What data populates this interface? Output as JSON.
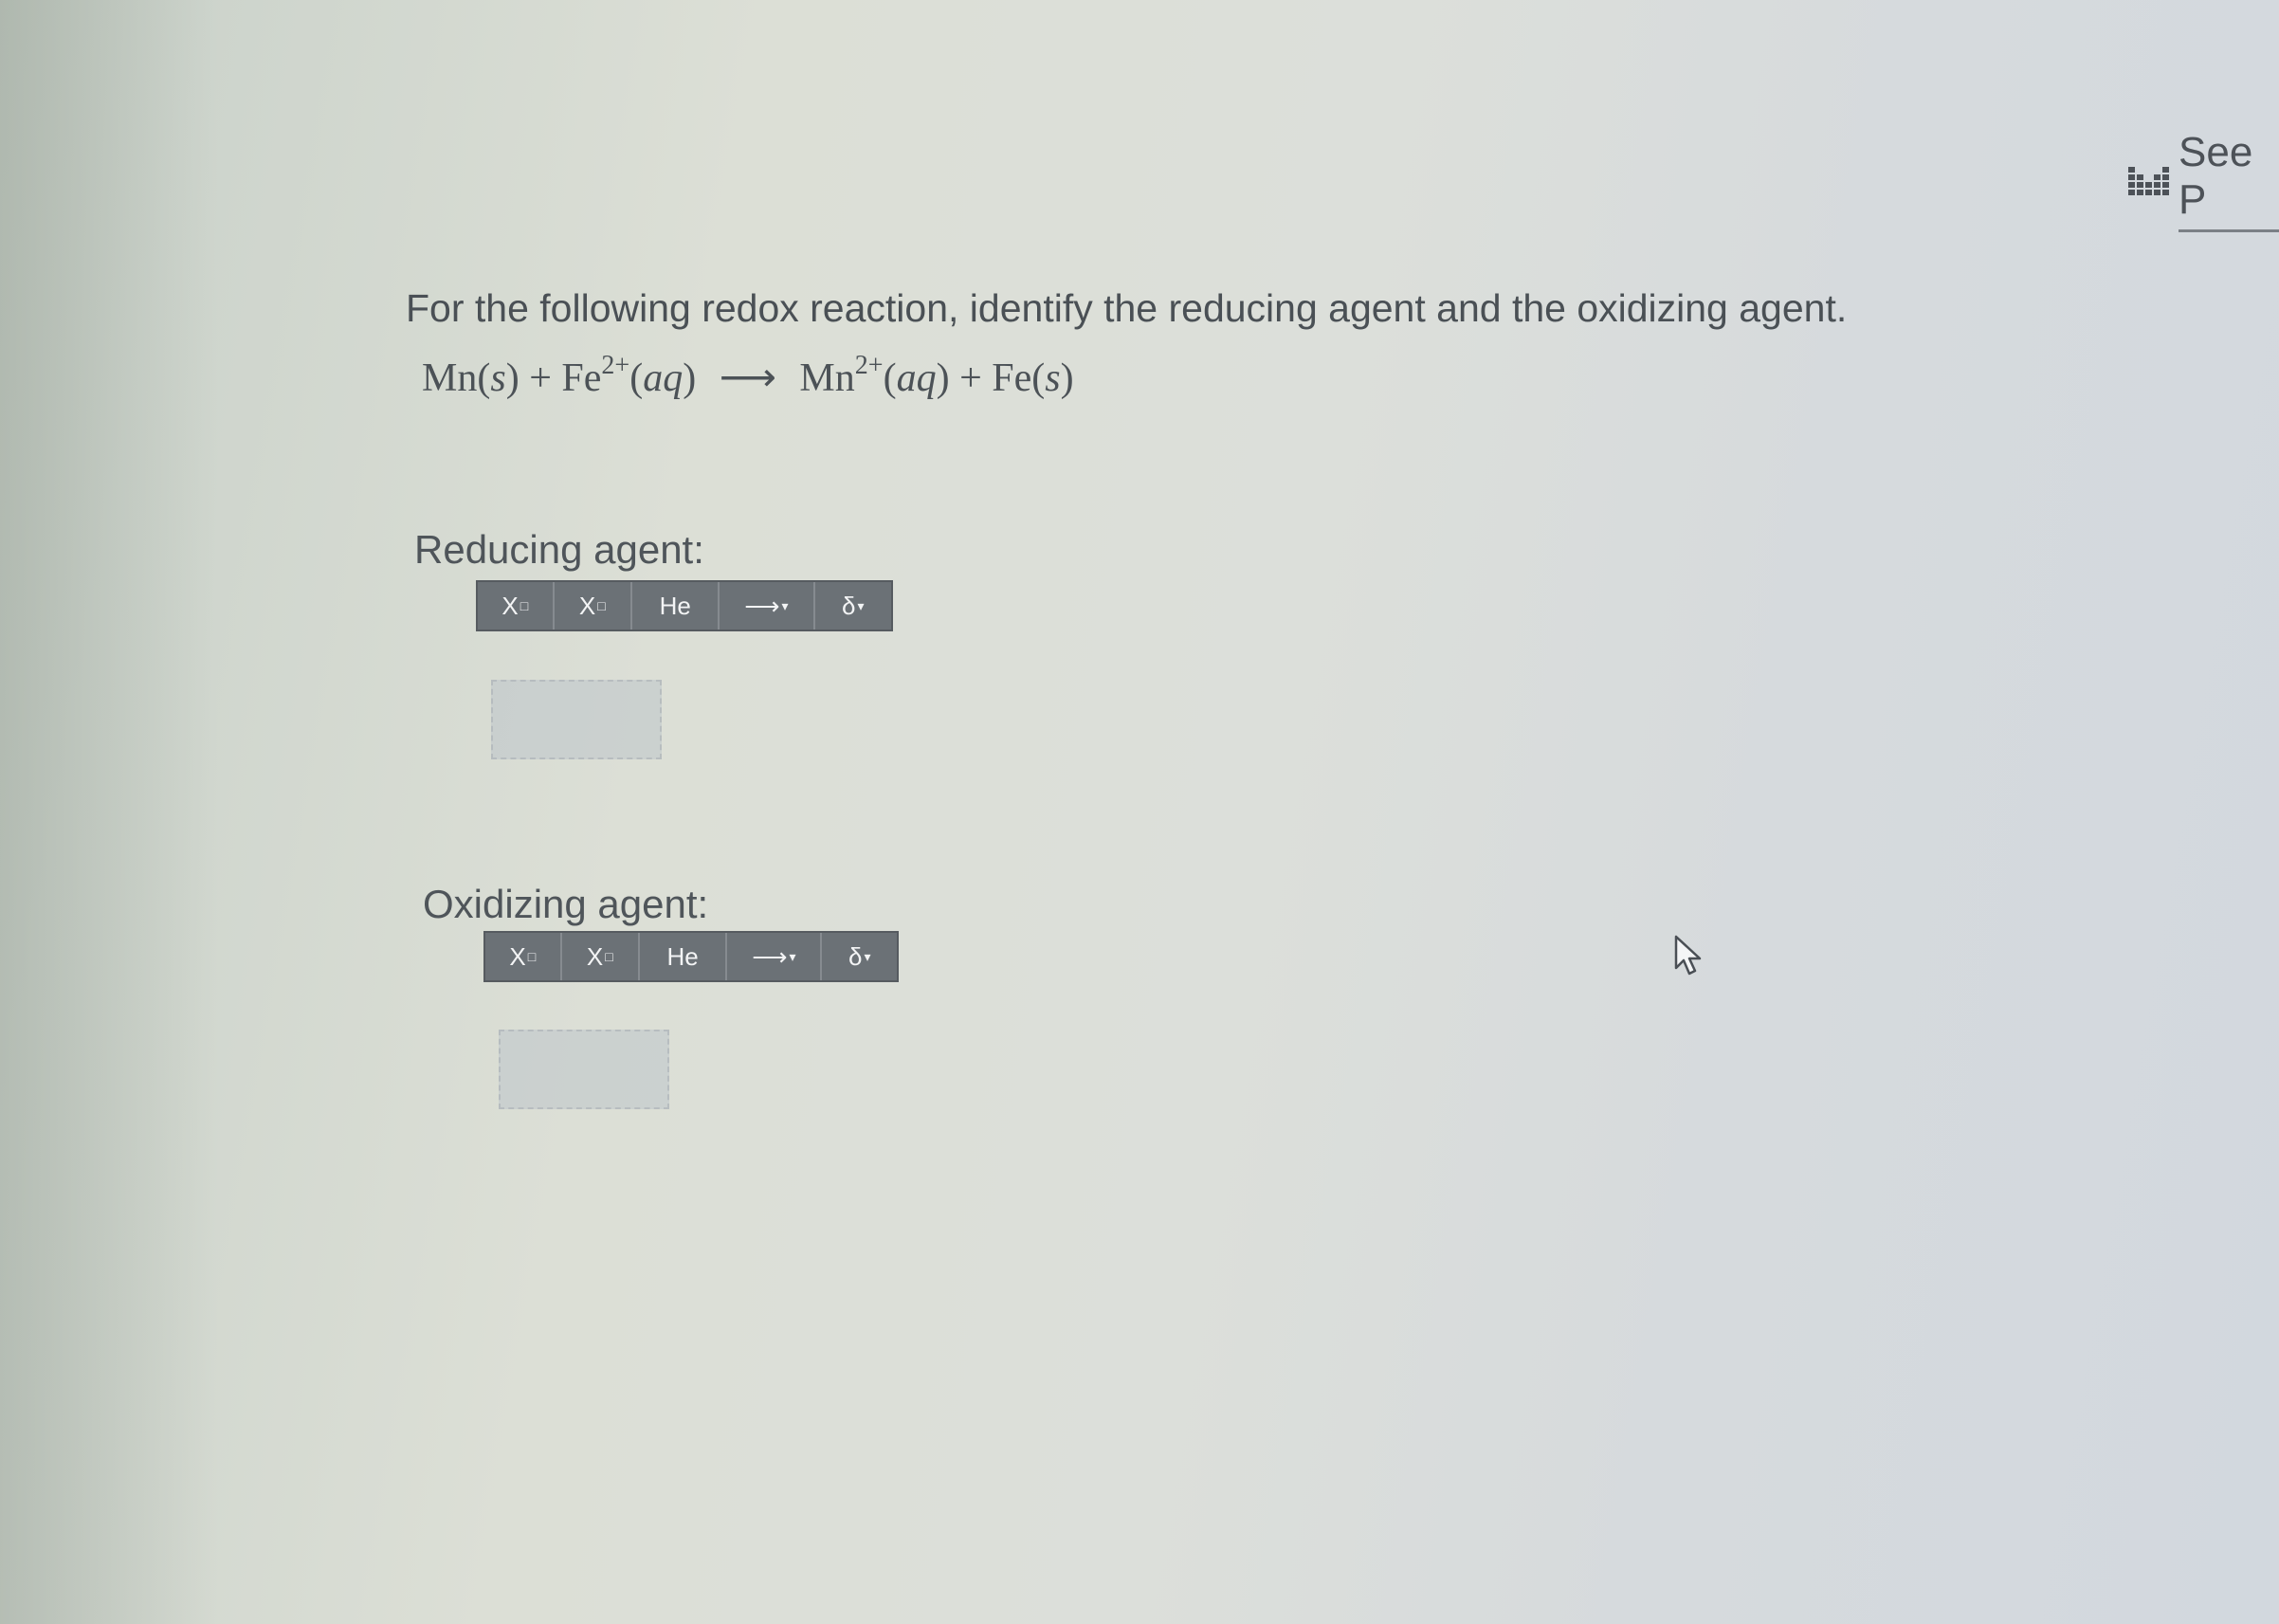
{
  "header": {
    "see_label": "See P"
  },
  "question": {
    "prompt": "For the following redox reaction, identify the reducing agent and the oxidizing agent.",
    "equation": {
      "r1": "Mn",
      "r1_state": "s",
      "plus": "+",
      "r2": "Fe",
      "r2_charge": "2+",
      "r2_state": "aq",
      "arrow": "⟶",
      "p1": "Mn",
      "p1_charge": "2+",
      "p1_state": "aq",
      "p2": "Fe",
      "p2_state": "s"
    }
  },
  "reducing": {
    "label": "Reducing agent:",
    "toolbar": [
      "X",
      "X",
      "He",
      "⟶",
      "δ"
    ]
  },
  "oxidizing": {
    "label": "Oxidizing agent:",
    "toolbar": [
      "X",
      "X",
      "He",
      "⟶",
      "δ"
    ]
  },
  "colors": {
    "toolbar_bg": "#6b7176",
    "text": "#4c5257"
  }
}
